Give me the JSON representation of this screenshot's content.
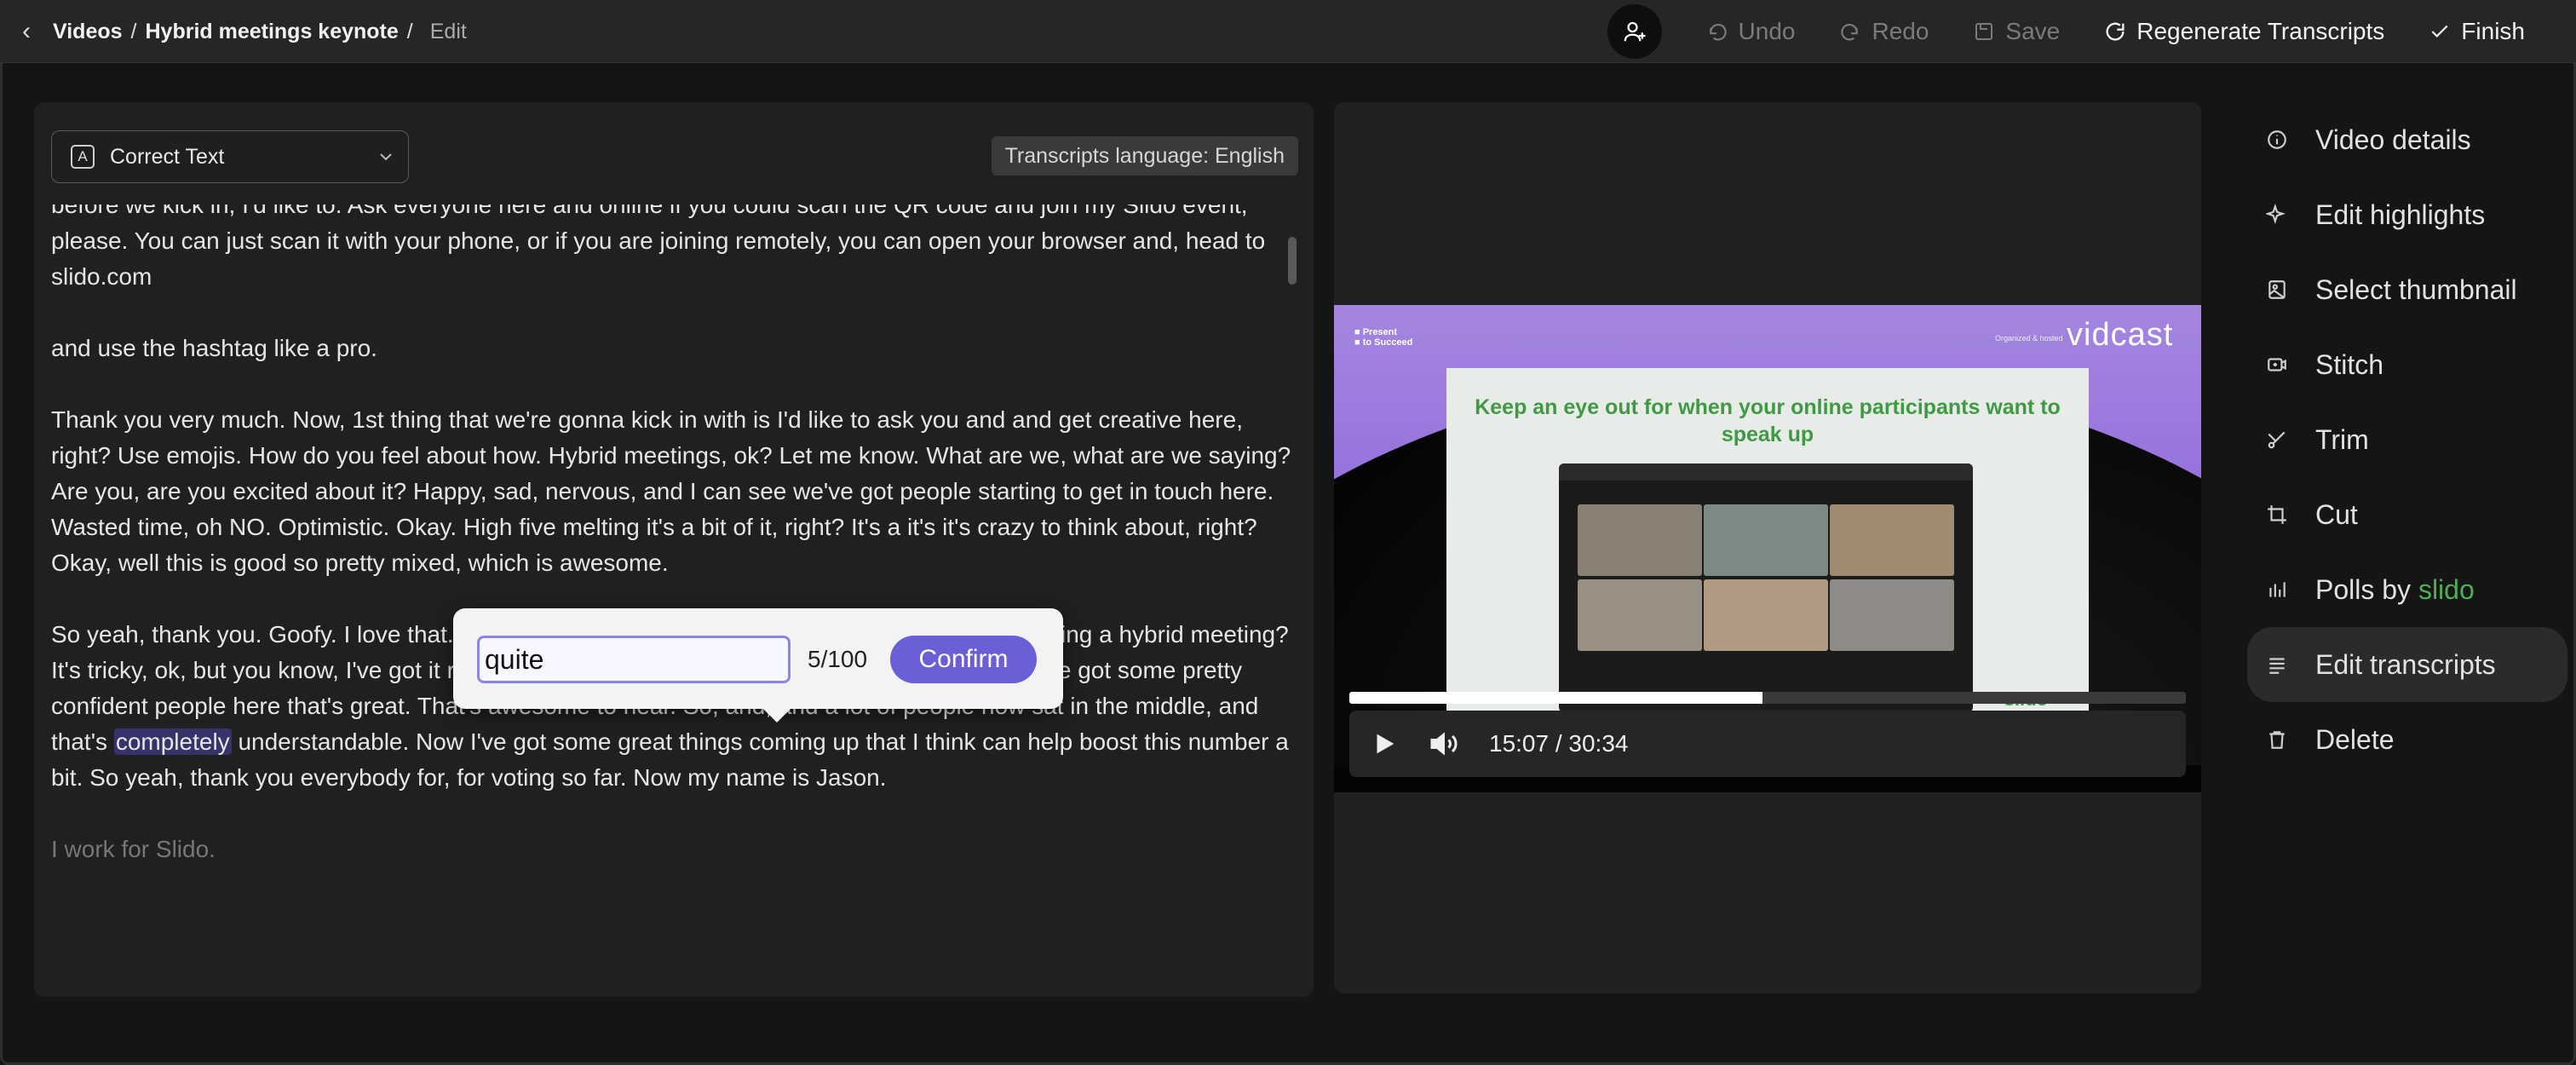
{
  "breadcrumb": {
    "root": "Videos",
    "video": "Hybrid meetings keynote",
    "current": "Edit"
  },
  "toolbar": {
    "undo": "Undo",
    "redo": "Redo",
    "save": "Save",
    "regenerate": "Regenerate Transcripts",
    "finish": "Finish",
    "user_icon": "add-user-icon"
  },
  "editor": {
    "mode": "Correct Text",
    "language": "Transcripts language: English",
    "paragraphs": [
      "before we kick in, I'd like to. Ask everyone here and online if you could scan the QR code and join my Slido event, please. You can just scan it with your phone, or if you are joining remotely, you can open your browser and, head to slido.com",
      "and use the hashtag like a pro.",
      "Thank you very much. Now, 1st thing that we're gonna kick in with is I'd like to ask you and and get creative here, right? Use emojis. How do you feel about how. Hybrid meetings, ok? Let me know. What are we, what are we saying? Are you, are you excited about it? Happy, sad, nervous, and I can see we've got people starting to get in touch here. Wasted time, oh NO. Optimistic. Okay. High five melting it's a bit of it, right? It's a it's it's crazy to think about, right? Okay, well this is good so pretty mixed, which is awesome."
    ],
    "p4": {
      "before": "So yeah, thank you. Goofy. I love that. Okay, so how confident do you feel when you are facilitating a hybrid meeting? It's tricky, ok, but you know, I've got it right. What do we think? So we've got some, actually we've got some pretty confident people here that's great. That's awesome to hear. So, and, and a lot of people now sat in the middle, and that's ",
      "highlight": "completely",
      "after": " understandable. Now I've got some great things coming up that I think can help boost this number a bit. So yeah, thank you everybody for, for voting so far. Now my name is Jason."
    },
    "last": "I work for Slido."
  },
  "popover": {
    "value": "quite",
    "counter": "5/100",
    "confirm": "Confirm"
  },
  "video": {
    "brand_left": "Present\nto Succeed",
    "brand_small": "Organized & hosted",
    "brand_right": "vidcast",
    "slide_title": "Keep an eye out for when your online participants want to speak up",
    "slide_mark": "slido",
    "time": "15:07 / 30:34",
    "progress": 0.494
  },
  "menu": [
    {
      "label": "Video details",
      "icon": "info-icon"
    },
    {
      "label": "Edit highlights",
      "icon": "sparkle-icon"
    },
    {
      "label": "Select thumbnail",
      "icon": "image-icon"
    },
    {
      "label": "Stitch",
      "icon": "stitch-icon"
    },
    {
      "label": "Trim",
      "icon": "scissors-icon"
    },
    {
      "label": "Cut",
      "icon": "crop-icon"
    },
    {
      "label": "Polls by ",
      "label_accent": "slido",
      "icon": "poll-icon"
    },
    {
      "label": "Edit transcripts",
      "icon": "lines-icon",
      "active": true
    },
    {
      "label": "Delete",
      "icon": "trash-icon"
    }
  ],
  "colors": {
    "accent": "#6a5fd7",
    "highlight_bg": "#37336a",
    "slido_green": "#4fae55"
  }
}
